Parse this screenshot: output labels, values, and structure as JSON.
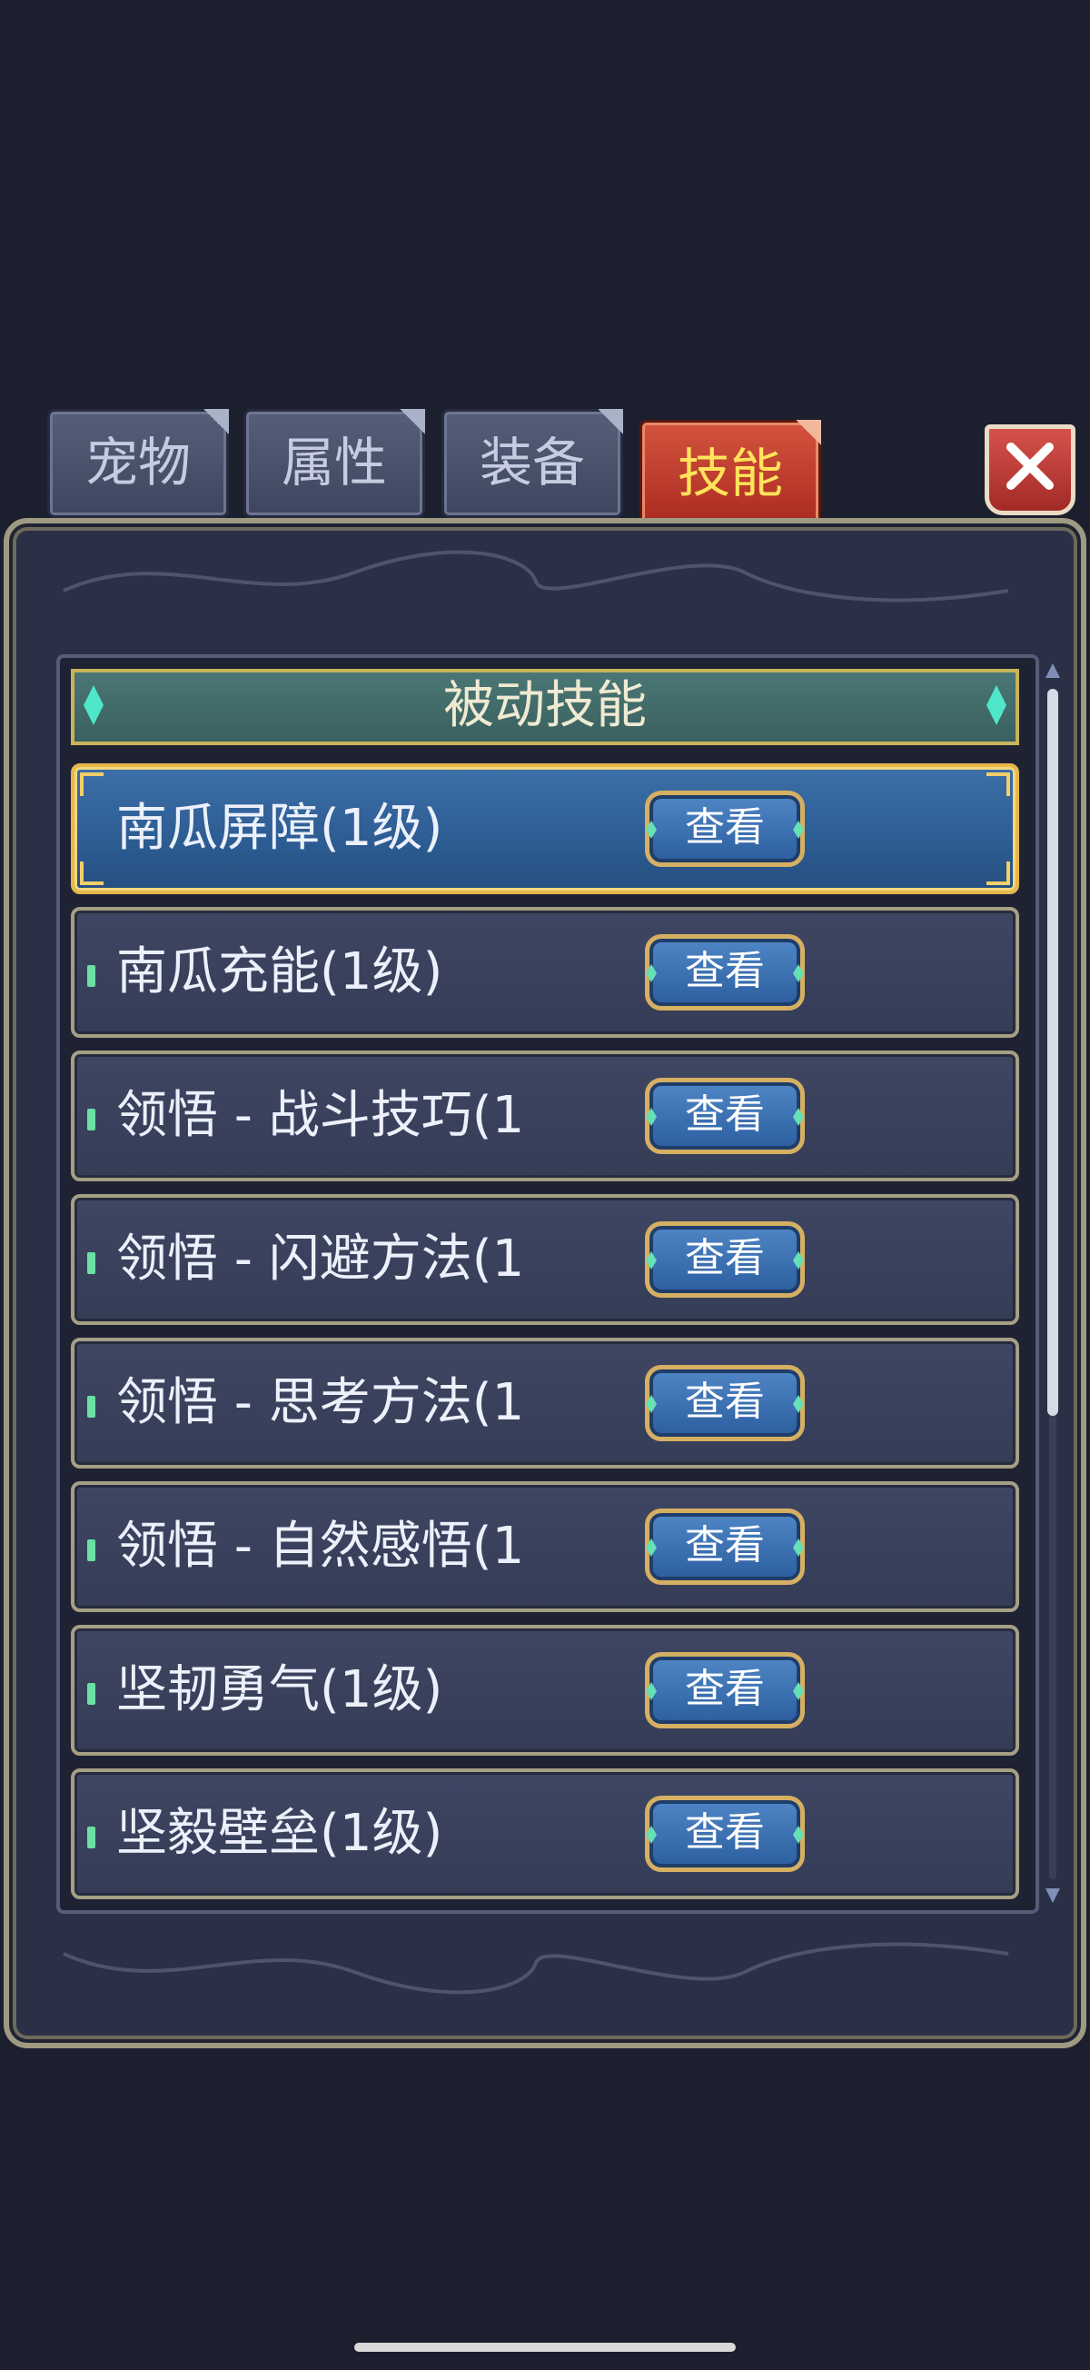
{
  "tabs": [
    {
      "label": "宠物",
      "active": false
    },
    {
      "label": "属性",
      "active": false
    },
    {
      "label": "装备",
      "active": false
    },
    {
      "label": "技能",
      "active": true
    }
  ],
  "panel": {
    "section_title": "被动技能",
    "view_label": "查看",
    "skills": [
      {
        "name": "南瓜屏障(1级)",
        "selected": true
      },
      {
        "name": "南瓜充能(1级)",
        "selected": false
      },
      {
        "name": "领悟 - 战斗技巧(1",
        "selected": false
      },
      {
        "name": "领悟 - 闪避方法(1",
        "selected": false
      },
      {
        "name": "领悟 - 思考方法(1",
        "selected": false
      },
      {
        "name": "领悟 - 自然感悟(1",
        "selected": false
      },
      {
        "name": "坚韧勇气(1级)",
        "selected": false
      },
      {
        "name": "坚毅壁垒(1级)",
        "selected": false
      }
    ]
  },
  "icons": {
    "close": "close-x-icon"
  },
  "colors": {
    "background": "#1c1f2e",
    "active_tab": "#c23e2f",
    "active_tab_text": "#ffe35a",
    "selected_row": "#2f5f95",
    "gold_border": "#e6b84b",
    "view_button": "#3a6fb0"
  }
}
